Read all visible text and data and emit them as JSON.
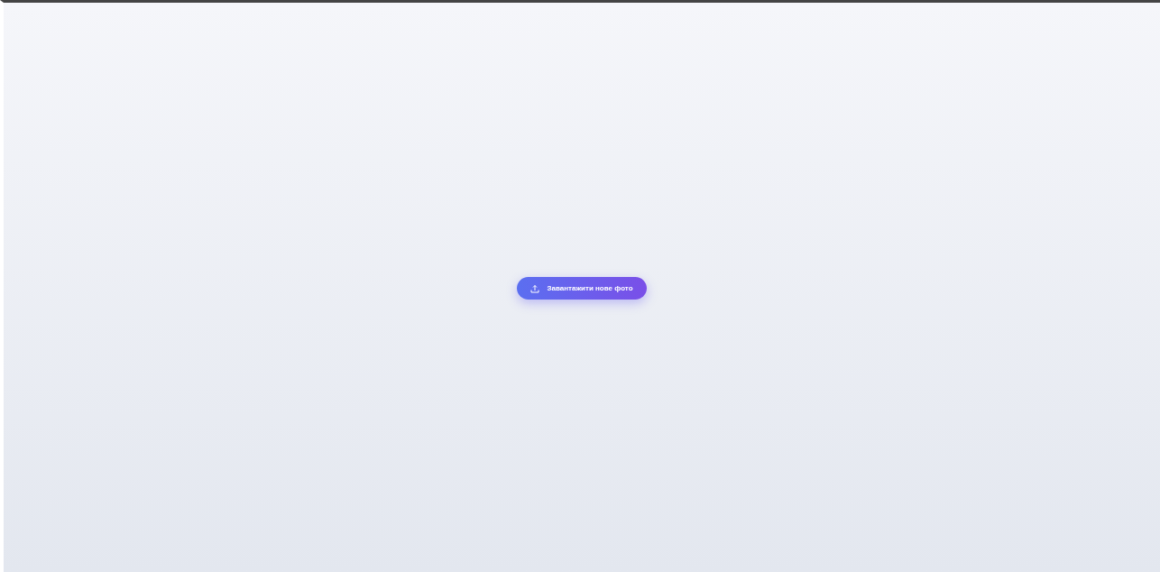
{
  "upload_button": {
    "label": "Завантажити нове фото"
  }
}
